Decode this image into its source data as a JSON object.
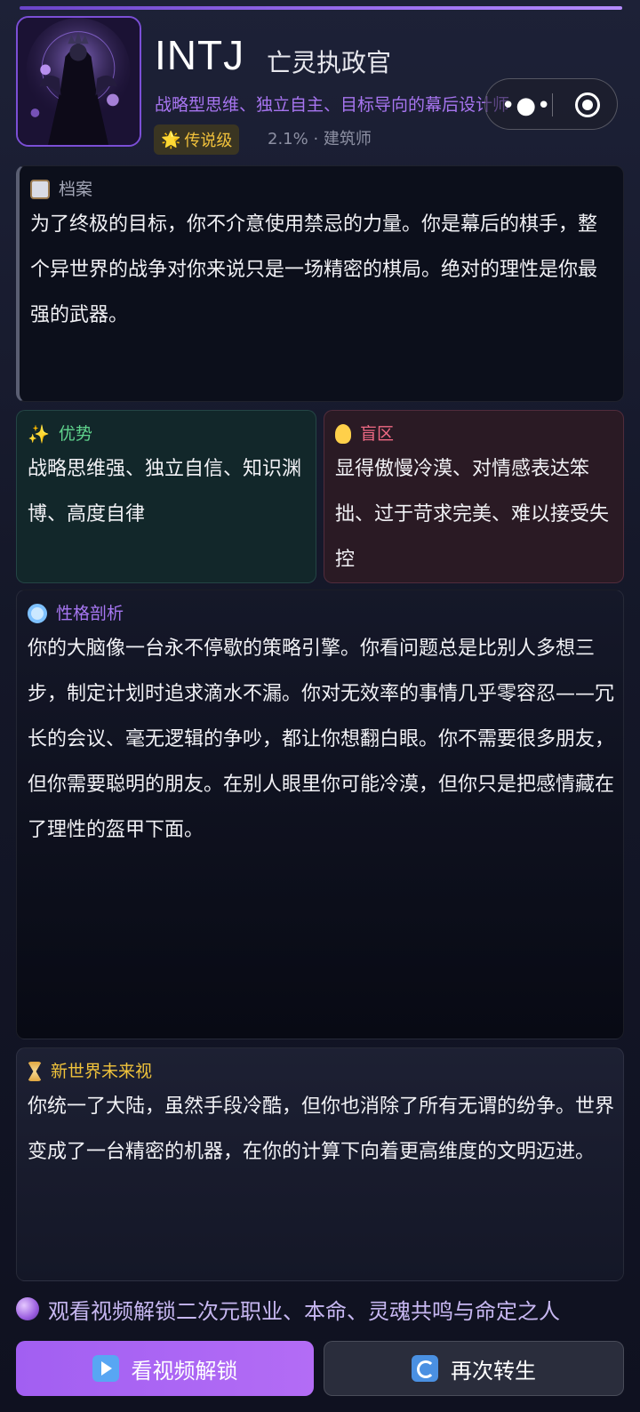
{
  "header": {
    "type_code": "INTJ",
    "type_name": "亡灵执政官",
    "tagline": "战略型思维、独立自主、目标导向的幕后设计师",
    "rarity_icon": "sun-sparkle-icon",
    "rarity": "传说级",
    "meta": "2.1% · 建筑师"
  },
  "archive": {
    "icon": "clipboard-icon",
    "title": "档案",
    "text": "为了终极的目标，你不介意使用禁忌的力量。你是幕后的棋手，整个异世界的战争对你来说只是一场精密的棋局。绝对的理性是你最强的武器。"
  },
  "strengths": {
    "icon": "sparkles-icon",
    "title": "优势",
    "text": "战略思维强、独立自信、知识渊博、高度自律"
  },
  "blindspots": {
    "icon": "light-bulb-icon",
    "title": "盲区",
    "text": "显得傲慢冷漠、对情感表达笨拙、过于苛求完美、难以接受失控"
  },
  "analysis": {
    "icon": "magnifier-icon",
    "title": "性格剖析",
    "text": "你的大脑像一台永不停歇的策略引擎。你看问题总是比别人多想三步，制定计划时追求滴水不漏。你对无效率的事情几乎零容忍——冗长的会议、毫无逻辑的争吵，都让你想翻白眼。你不需要很多朋友，但你需要聪明的朋友。在别人眼里你可能冷漠，但你只是把感情藏在了理性的盔甲下面。"
  },
  "future": {
    "icon": "hourglass-icon",
    "title": "新世界未来视",
    "text": "你统一了大陆，虽然手段冷酷，但你也消除了所有无谓的纷争。世界变成了一台精密的机器，在你的计算下向着更高维度的文明迈进。"
  },
  "unlock_hint": "观看视频解锁二次元职业、本命、灵魂共鸣与命定之人",
  "buttons": {
    "watch_video": "看视频解锁",
    "reincarnate": "再次转生"
  },
  "colors": {
    "accent_purple": "#a25ff2",
    "strength_green": "#5fd28c",
    "blind_red": "#f06a84",
    "legend_gold": "#f1c13b"
  }
}
